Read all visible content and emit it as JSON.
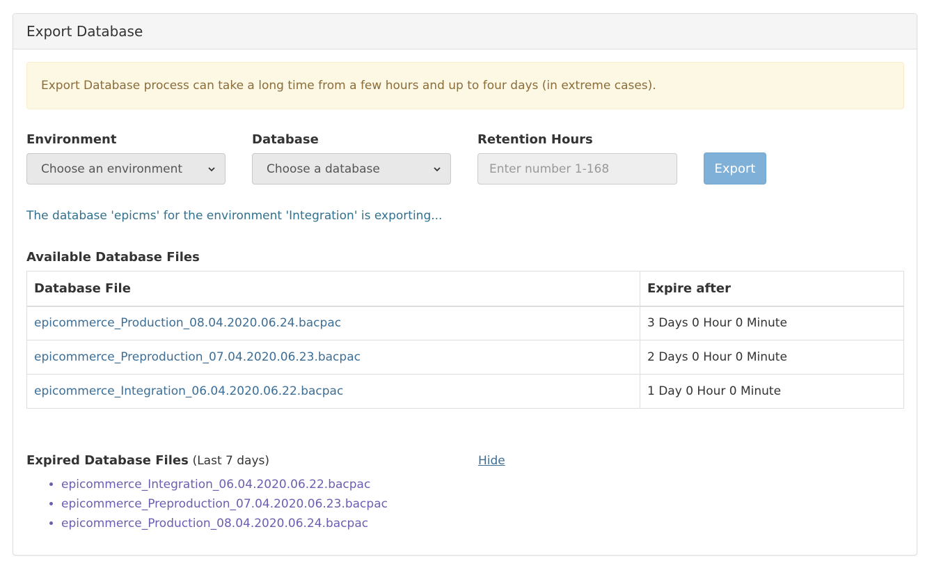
{
  "panel": {
    "title": "Export Database"
  },
  "alert": {
    "text": "Export Database process can take a long time from a few hours and up to four days (in extreme cases)."
  },
  "form": {
    "environment": {
      "label": "Environment",
      "value": "Choose an environment"
    },
    "database": {
      "label": "Database",
      "value": "Choose a database"
    },
    "retention": {
      "label": "Retention Hours",
      "placeholder": "Enter number 1-168"
    },
    "export_label": "Export"
  },
  "status": {
    "text": "The database 'epicms' for the environment 'Integration' is exporting..."
  },
  "available": {
    "title": "Available Database Files",
    "headers": {
      "file": "Database File",
      "expire": "Expire after"
    },
    "rows": [
      {
        "file": "epicommerce_Production_08.04.2020.06.24.bacpac",
        "expire": "3 Days 0 Hour 0 Minute"
      },
      {
        "file": "epicommerce_Preproduction_07.04.2020.06.23.bacpac",
        "expire": "2 Days 0 Hour 0 Minute"
      },
      {
        "file": "epicommerce_Integration_06.04.2020.06.22.bacpac",
        "expire": "1 Day 0 Hour 0 Minute"
      }
    ]
  },
  "expired": {
    "title": "Expired Database Files",
    "subtitle": "(Last 7 days)",
    "hide_label": "Hide",
    "items": [
      "epicommerce_Integration_06.04.2020.06.22.bacpac",
      "epicommerce_Preproduction_07.04.2020.06.23.bacpac",
      "epicommerce_Production_08.04.2020.06.24.bacpac"
    ]
  },
  "colors": {
    "alert_bg": "#fcf8e3",
    "alert_text": "#8a6d3b",
    "status_text": "#31708f",
    "link": "#3d6e96",
    "expired_link": "#6a5fb0",
    "export_button": "#7fb0d8"
  }
}
